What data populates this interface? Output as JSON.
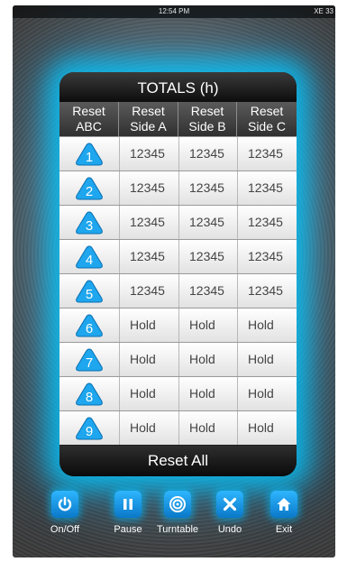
{
  "status_bar": {
    "time": "12:54 PM",
    "carrier": "XE 33"
  },
  "panel": {
    "title": "TOTALS (h)"
  },
  "headers": [
    {
      "line1": "Reset",
      "line2": "ABC"
    },
    {
      "line1": "Reset",
      "line2": "Side A"
    },
    {
      "line1": "Reset",
      "line2": "Side B"
    },
    {
      "line1": "Reset",
      "line2": "Side C"
    }
  ],
  "rows": [
    {
      "num": "1",
      "a": "12345",
      "b": "12345",
      "c": "12345"
    },
    {
      "num": "2",
      "a": "12345",
      "b": "12345",
      "c": "12345"
    },
    {
      "num": "3",
      "a": "12345",
      "b": "12345",
      "c": "12345"
    },
    {
      "num": "4",
      "a": "12345",
      "b": "12345",
      "c": "12345"
    },
    {
      "num": "5",
      "a": "12345",
      "b": "12345",
      "c": "12345"
    },
    {
      "num": "6",
      "a": "Hold",
      "b": "Hold",
      "c": "Hold"
    },
    {
      "num": "7",
      "a": "Hold",
      "b": "Hold",
      "c": "Hold"
    },
    {
      "num": "8",
      "a": "Hold",
      "b": "Hold",
      "c": "Hold"
    },
    {
      "num": "9",
      "a": "Hold",
      "b": "Hold",
      "c": "Hold"
    }
  ],
  "reset_all_label": "Reset All",
  "toolbar": [
    {
      "label": "On/Off",
      "icon": "power-icon"
    },
    {
      "label": "Pause",
      "icon": "pause-icon"
    },
    {
      "label": "Turntable",
      "icon": "turntable-icon"
    },
    {
      "label": "Undo",
      "icon": "undo-x-icon"
    },
    {
      "label": "Exit",
      "icon": "home-icon"
    }
  ],
  "colors": {
    "accent": "#19a9f0",
    "glow": "#00c8ff"
  }
}
